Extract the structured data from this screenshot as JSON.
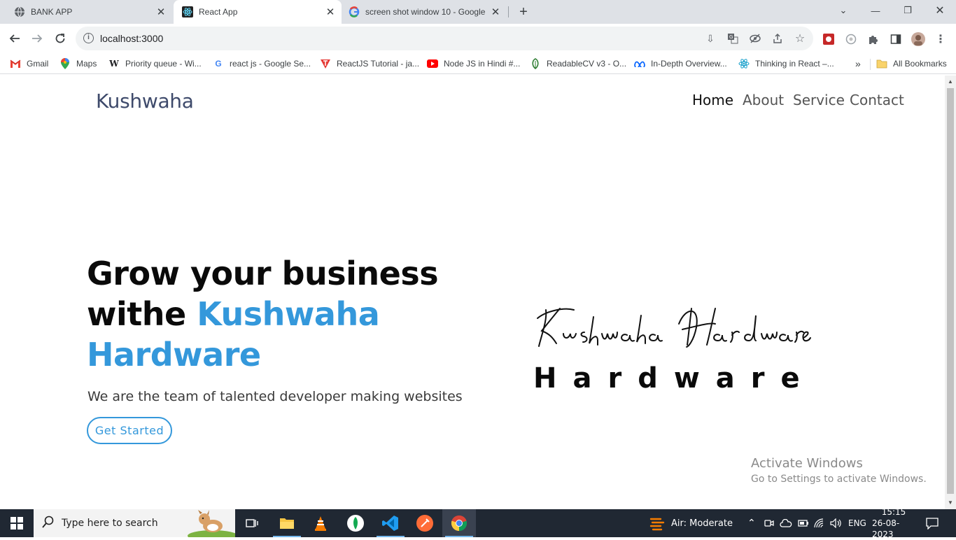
{
  "browser": {
    "tabs": [
      {
        "label": "BANK APP",
        "icon": "globe-icon"
      },
      {
        "label": "React App",
        "icon": "react-icon",
        "active": true
      },
      {
        "label": "screen shot window 10 - Google",
        "icon": "google-icon"
      }
    ],
    "url": "localhost:3000",
    "bookmarks": [
      {
        "label": "Gmail",
        "icon": "gmail-icon"
      },
      {
        "label": "Maps",
        "icon": "maps-icon"
      },
      {
        "label": "Priority queue - Wi...",
        "icon": "wikipedia-icon"
      },
      {
        "label": "react js - Google Se...",
        "icon": "google-icon"
      },
      {
        "label": "ReactJS Tutorial - ja...",
        "icon": "tpoint-icon"
      },
      {
        "label": "Node JS in Hindi #...",
        "icon": "youtube-icon"
      },
      {
        "label": "ReadableCV v3 - O...",
        "icon": "leaf-icon"
      },
      {
        "label": "In-Depth Overview...",
        "icon": "meta-icon"
      },
      {
        "label": "Thinking in React –...",
        "icon": "react-icon"
      }
    ],
    "bookmarks_more": "»",
    "all_bookmarks": "All Bookmarks"
  },
  "site": {
    "brand": "Kushwaha",
    "nav": [
      "Home",
      "About",
      "Service",
      "Contact"
    ],
    "hero_line1": "Grow your business",
    "hero_line2a": "withe ",
    "hero_line2b": "Kushwaha",
    "hero_line3": "Hardware",
    "hero_sub": "We are the team of talented developer making websites",
    "cta": "Get Started",
    "logo_script": "Kushwaha Hardware",
    "logo_word": "Hardware",
    "accent_color": "#3498db"
  },
  "os": {
    "watermark_title": "Activate Windows",
    "watermark_sub": "Go to Settings to activate Windows.",
    "search_placeholder": "Type here to search",
    "weather": "Air: Moderate",
    "lang": "ENG",
    "time": "15:15",
    "date": "26-08-2023"
  }
}
